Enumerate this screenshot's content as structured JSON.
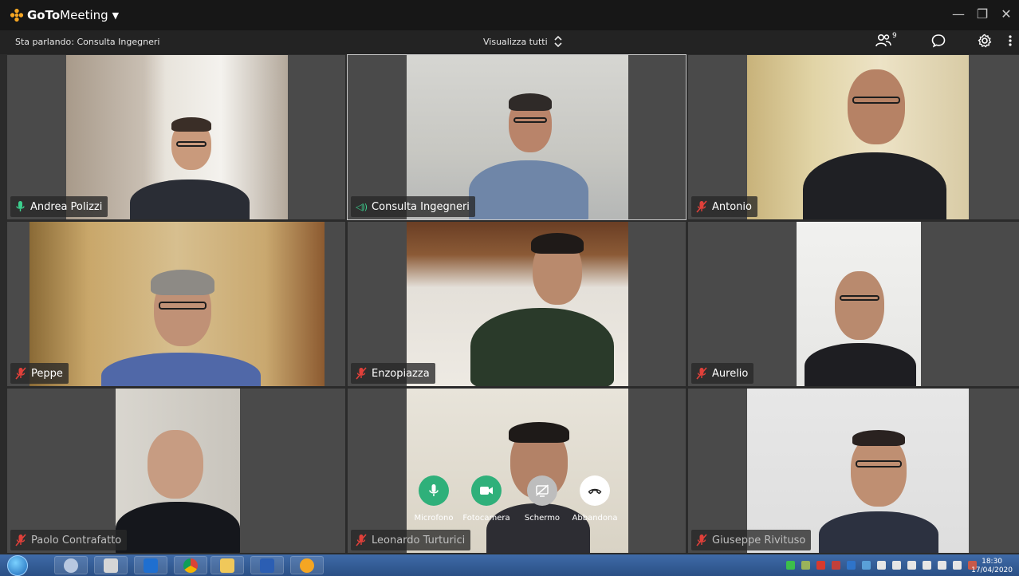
{
  "app": {
    "brand_go": "GoTo",
    "brand_meeting": "Meeting",
    "speaking": "Sta parlando: Consulta Ingegneri",
    "view_all": "Visualizza tutti",
    "participant_count": "9"
  },
  "participants": [
    {
      "name": "Andrea Polizzi",
      "mic": "on"
    },
    {
      "name": "Consulta Ingegneri",
      "mic": "speaking"
    },
    {
      "name": "Antonio",
      "mic": "muted"
    },
    {
      "name": "Peppe",
      "mic": "muted"
    },
    {
      "name": "Enzopiazza",
      "mic": "muted"
    },
    {
      "name": "Aurelio",
      "mic": "muted"
    },
    {
      "name": "Paolo Contrafatto",
      "mic": "muted"
    },
    {
      "name": "Leonardo Turturici",
      "mic": "muted"
    },
    {
      "name": "Giuseppe Rivituso",
      "mic": "muted"
    }
  ],
  "controls": {
    "microphone": "Microfono",
    "camera": "Fotocamera",
    "screen": "Schermo",
    "leave": "Abbandona"
  },
  "taskbar": {
    "time": "18:30",
    "date": "17/04/2020"
  },
  "colors": {
    "accent_green": "#2fb07a",
    "mute_red": "#e0403a",
    "brand_orange": "#f5a623"
  }
}
